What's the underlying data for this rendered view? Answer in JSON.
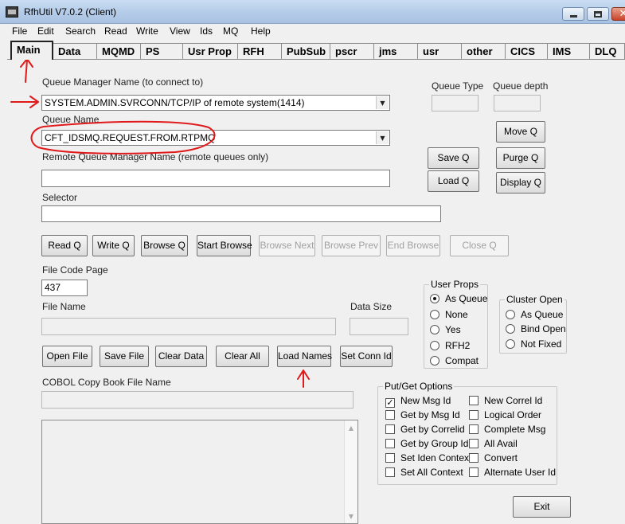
{
  "window": {
    "title": "RfhUtil V7.0.2 (Client)"
  },
  "menu": [
    "File",
    "Edit",
    "Search",
    "Read",
    "Write",
    "View",
    "Ids",
    "MQ",
    "Help"
  ],
  "tabs": [
    "Main",
    "Data",
    "MQMD",
    "PS",
    "Usr Prop",
    "RFH",
    "PubSub",
    "pscr",
    "jms",
    "usr",
    "other",
    "CICS",
    "IMS",
    "DLQ"
  ],
  "qmgr": {
    "label": "Queue Manager Name (to connect to)",
    "value": "SYSTEM.ADMIN.SVRCONN/TCP/IP of remote system(1414)"
  },
  "queue": {
    "label": "Queue Name",
    "value": "CFT_IDSMQ.REQUEST.FROM.RTPMQ"
  },
  "remote_qmgr": {
    "label": "Remote Queue Manager Name (remote queues only)",
    "value": ""
  },
  "selector": {
    "label": "Selector",
    "value": ""
  },
  "queue_type": {
    "label": "Queue Type",
    "value": ""
  },
  "queue_depth": {
    "label": "Queue depth",
    "value": ""
  },
  "right_buttons": {
    "move": "Move Q",
    "save": "Save Q",
    "purge": "Purge Q",
    "load": "Load Q",
    "display": "Display Q"
  },
  "action_buttons": {
    "read": "Read Q",
    "write": "Write Q",
    "browse": "Browse Q",
    "start_browse": "Start Browse",
    "browse_next": "Browse Next",
    "browse_prev": "Browse Prev",
    "end_browse": "End Browse",
    "close": "Close Q"
  },
  "file_code_page": {
    "label": "File Code Page",
    "value": "437"
  },
  "file_name": {
    "label": "File Name",
    "value": ""
  },
  "data_size": {
    "label": "Data Size",
    "value": ""
  },
  "file_buttons": {
    "open": "Open File",
    "save": "Save File",
    "clear_data": "Clear Data",
    "clear_all": "Clear All",
    "load_names": "Load Names",
    "set_conn_id": "Set Conn Id"
  },
  "cobol": {
    "label": "COBOL Copy Book File Name",
    "value": ""
  },
  "user_props": {
    "title": "User Props",
    "options": [
      "As Queue",
      "None",
      "Yes",
      "RFH2",
      "Compat"
    ],
    "selected": "As Queue"
  },
  "cluster_open": {
    "title": "Cluster Open",
    "options": [
      "As Queue",
      "Bind Open",
      "Not Fixed"
    ]
  },
  "put_get": {
    "title": "Put/Get Options",
    "left": [
      {
        "label": "New Msg Id",
        "checked": true
      },
      {
        "label": "Get by Msg Id",
        "checked": false
      },
      {
        "label": "Get by Correlid",
        "checked": false
      },
      {
        "label": "Get by Group Id",
        "checked": false
      },
      {
        "label": "Set Iden Context",
        "checked": false
      },
      {
        "label": "Set All Context",
        "checked": false
      }
    ],
    "right": [
      {
        "label": "New Correl Id",
        "checked": false
      },
      {
        "label": "Logical Order",
        "checked": false
      },
      {
        "label": "Complete Msg",
        "checked": false
      },
      {
        "label": "All Avail",
        "checked": false
      },
      {
        "label": "Convert",
        "checked": false
      },
      {
        "label": "Alternate User Id",
        "checked": false
      }
    ]
  },
  "exit_label": "Exit",
  "colors": {
    "annotation": "#e0191b",
    "titlebar": "#b6cde9"
  }
}
